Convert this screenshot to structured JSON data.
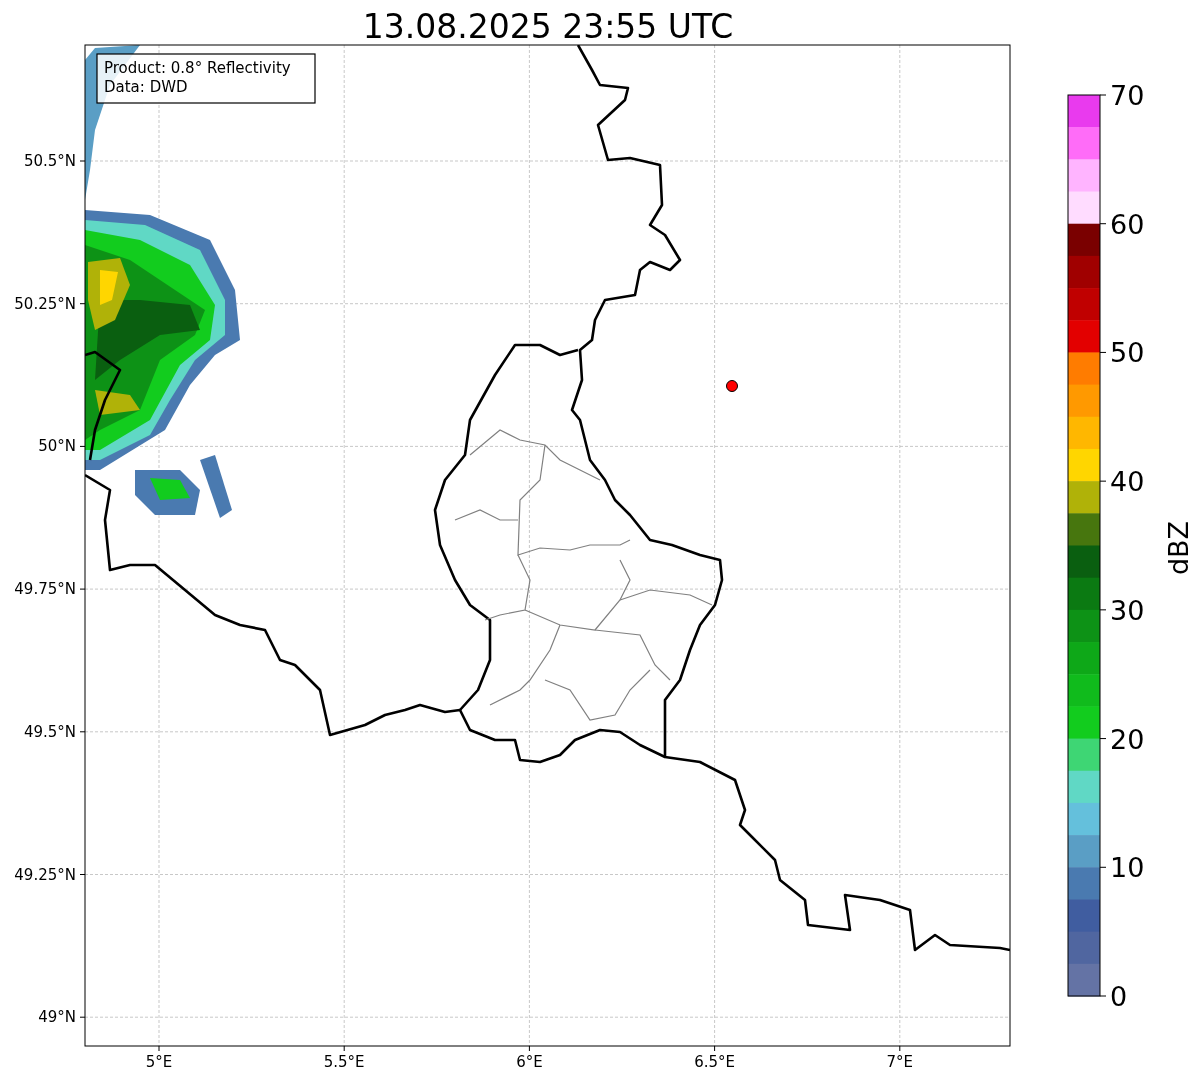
{
  "title": "13.08.2025 23:55 UTC",
  "info_box": [
    "Product: 0.8° Reflectivity",
    "Data: DWD"
  ],
  "y_ticks": [
    "50.5°N",
    "50.25°N",
    "50°N",
    "49.75°N",
    "49.5°N",
    "49.25°N",
    "49°N"
  ],
  "x_ticks": [
    "5°E",
    "5.5°E",
    "6°E",
    "6.5°E",
    "7°E"
  ],
  "colorbar": {
    "label": "dBZ",
    "ticks": [
      "70",
      "60",
      "50",
      "40",
      "30",
      "20",
      "10",
      "0"
    ],
    "segments": [
      {
        "color": "#e93aee"
      },
      {
        "color": "#ff6cf8"
      },
      {
        "color": "#ffb4ff"
      },
      {
        "color": "#ffdcff"
      },
      {
        "color": "#7a0000"
      },
      {
        "color": "#a00000"
      },
      {
        "color": "#c00000"
      },
      {
        "color": "#e30000"
      },
      {
        "color": "#ff7c00"
      },
      {
        "color": "#ff9900"
      },
      {
        "color": "#ffb700"
      },
      {
        "color": "#ffd600"
      },
      {
        "color": "#b0b208"
      },
      {
        "color": "#47760e"
      },
      {
        "color": "#0a5f10"
      },
      {
        "color": "#0b7a12"
      },
      {
        "color": "#0d9216"
      },
      {
        "color": "#0ea818"
      },
      {
        "color": "#10bb1c"
      },
      {
        "color": "#12cc1e"
      },
      {
        "color": "#3ed674"
      },
      {
        "color": "#60d8c5"
      },
      {
        "color": "#64c0dc"
      },
      {
        "color": "#5a9ec5"
      },
      {
        "color": "#4a7ab0"
      },
      {
        "color": "#405da0"
      },
      {
        "color": "#5066a0"
      },
      {
        "color": "#6473a5"
      }
    ]
  }
}
